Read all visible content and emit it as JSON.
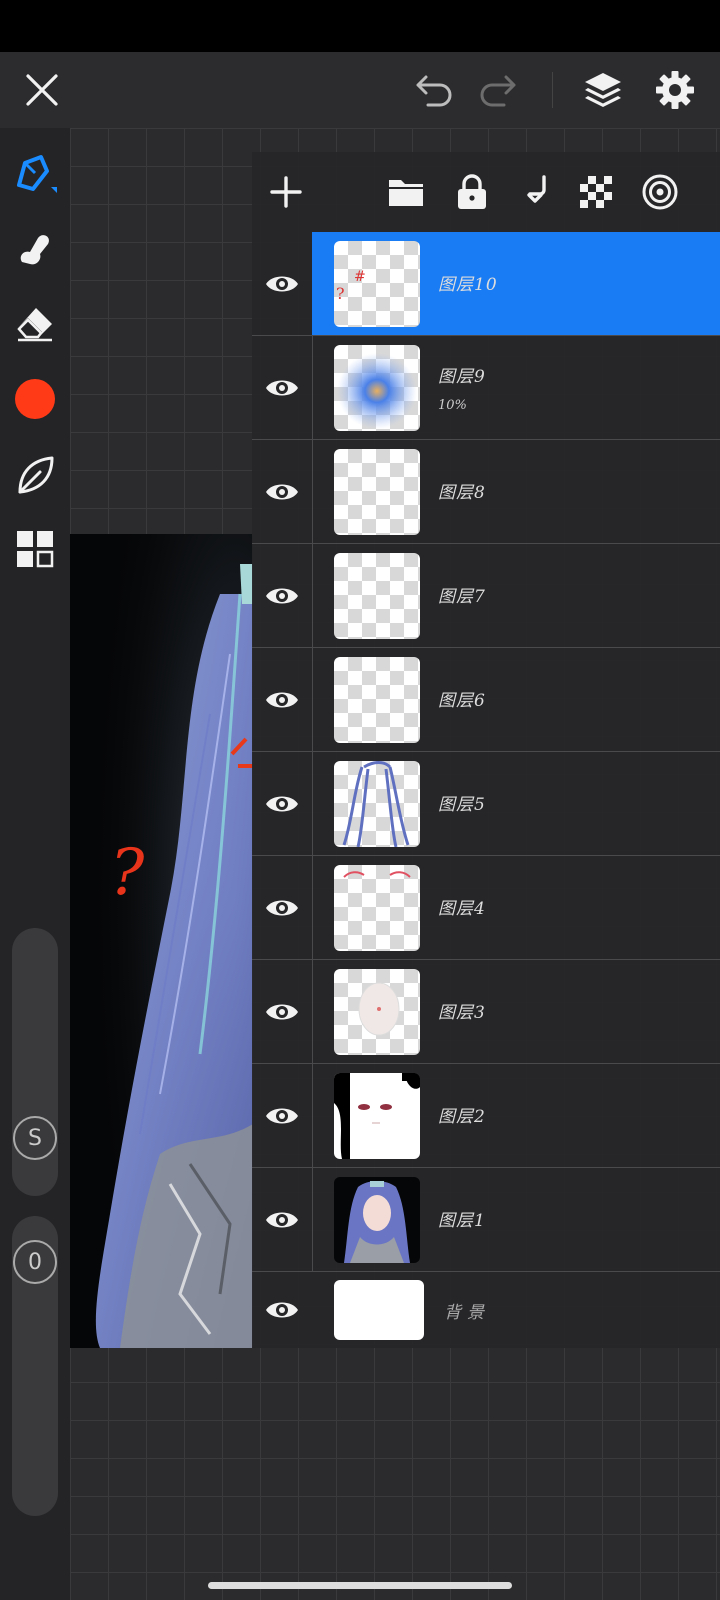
{
  "toolbar_top": {
    "close_icon": "close-icon",
    "undo_icon": "undo-icon",
    "redo_icon": "redo-icon",
    "layers_icon": "layers-icon",
    "settings_icon": "gear-icon"
  },
  "left_tools": {
    "items": [
      "pen-icon",
      "smudge-icon",
      "eraser-icon",
      "color-swatch",
      "leaf-icon",
      "gallery-grid-icon"
    ],
    "active_color": "#ff3b17",
    "size_badge": "S",
    "opacity_badge": "0"
  },
  "layers_panel": {
    "header_icons": [
      "add-icon",
      "folder-icon",
      "lock-icon",
      "merge-down-icon",
      "transparency-icon",
      "blend-icon"
    ],
    "layers": [
      {
        "name": "图层10",
        "opacity": "",
        "active": true
      },
      {
        "name": "图层9",
        "opacity": "10%",
        "active": false
      },
      {
        "name": "图层8",
        "opacity": "",
        "active": false
      },
      {
        "name": "图层7",
        "opacity": "",
        "active": false
      },
      {
        "name": "图层6",
        "opacity": "",
        "active": false
      },
      {
        "name": "图层5",
        "opacity": "",
        "active": false
      },
      {
        "name": "图层4",
        "opacity": "",
        "active": false
      },
      {
        "name": "图层3",
        "opacity": "",
        "active": false
      },
      {
        "name": "图层2",
        "opacity": "",
        "active": false
      },
      {
        "name": "图层1",
        "opacity": "",
        "active": false
      }
    ],
    "background_layer": {
      "name": "背景"
    }
  },
  "colors": {
    "accent": "#1a7cf4",
    "panel_bg": "#262629",
    "toolbar_bg": "#2c2c2e"
  }
}
